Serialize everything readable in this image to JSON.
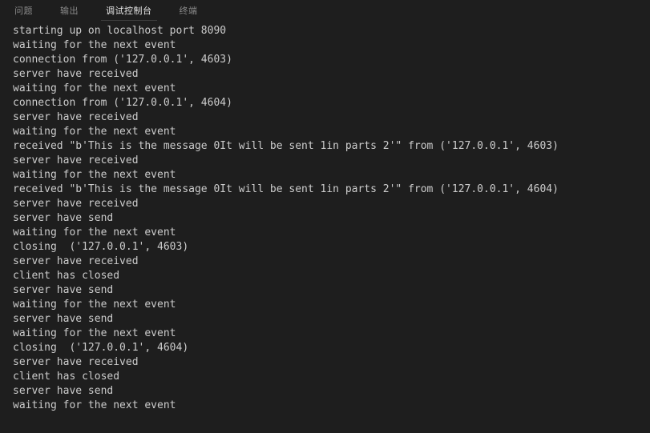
{
  "panel": {
    "background_color": "#1e1e1e",
    "text_color": "#cccccc",
    "inactive_tab_color": "#8a8a8a",
    "active_tab_color": "#e7e7e7"
  },
  "tabbar": {
    "tabs": [
      {
        "label": "问题",
        "active": false
      },
      {
        "label": "输出",
        "active": false
      },
      {
        "label": "调试控制台",
        "active": true
      },
      {
        "label": "终端",
        "active": false
      }
    ]
  },
  "console": {
    "lines": [
      "starting up on localhost port 8090",
      "waiting for the next event",
      "connection from ('127.0.0.1', 4603)",
      "server have received",
      "waiting for the next event",
      "connection from ('127.0.0.1', 4604)",
      "server have received",
      "waiting for the next event",
      "received \"b'This is the message 0It will be sent 1in parts 2'\" from ('127.0.0.1', 4603)",
      "server have received",
      "waiting for the next event",
      "received \"b'This is the message 0It will be sent 1in parts 2'\" from ('127.0.0.1', 4604)",
      "server have received",
      "server have send",
      "waiting for the next event",
      "closing  ('127.0.0.1', 4603)",
      "server have received",
      "client has closed",
      "server have send",
      "waiting for the next event",
      "server have send",
      "waiting for the next event",
      "closing  ('127.0.0.1', 4604)",
      "server have received",
      "client has closed",
      "server have send",
      "waiting for the next event"
    ]
  }
}
